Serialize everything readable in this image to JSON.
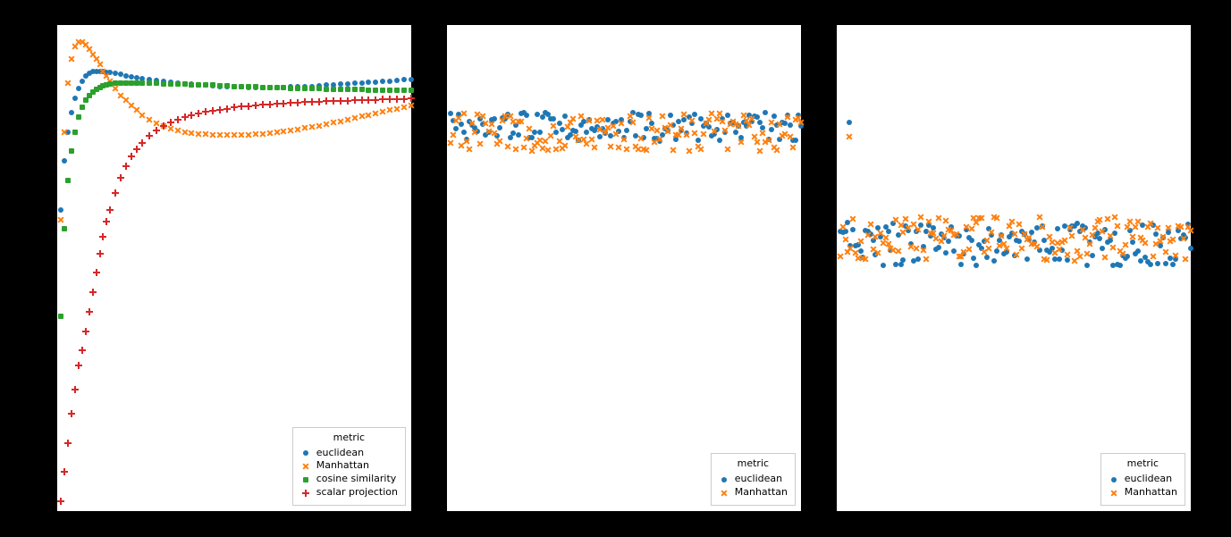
{
  "colors": {
    "euclidean": "#1f77b4",
    "manhattan": "#ff7f0e",
    "cosine": "#2ca02c",
    "scalar": "#d62728"
  },
  "legend_title": "metric",
  "legend_labels": {
    "euclidean": "euclidean",
    "manhattan": "Manhattan",
    "cosine": "cosine similarity",
    "scalar": "scalar projection"
  },
  "chart_data": [
    {
      "type": "scatter",
      "panel": "left",
      "xlim": [
        0,
        200
      ],
      "ylim": [
        0,
        1
      ],
      "legend_position": "lower right",
      "series": [
        {
          "name": "euclidean",
          "marker": "circle",
          "x": [
            2,
            4,
            6,
            8,
            10,
            12,
            14,
            16,
            18,
            20,
            22,
            24,
            26,
            28,
            30,
            33,
            36,
            39,
            42,
            45,
            48,
            52,
            56,
            60,
            64,
            68,
            72,
            76,
            80,
            84,
            88,
            92,
            96,
            100,
            104,
            108,
            112,
            116,
            120,
            124,
            128,
            132,
            136,
            140,
            144,
            148,
            152,
            156,
            160,
            164,
            168,
            172,
            176,
            180,
            184,
            188,
            192,
            196,
            200
          ],
          "y": [
            0.62,
            0.72,
            0.78,
            0.82,
            0.85,
            0.87,
            0.885,
            0.895,
            0.9,
            0.905,
            0.905,
            0.905,
            0.905,
            0.903,
            0.902,
            0.9,
            0.898,
            0.896,
            0.894,
            0.892,
            0.89,
            0.888,
            0.886,
            0.884,
            0.882,
            0.88,
            0.879,
            0.878,
            0.877,
            0.876,
            0.875,
            0.874,
            0.874,
            0.873,
            0.873,
            0.872,
            0.872,
            0.872,
            0.872,
            0.872,
            0.872,
            0.873,
            0.873,
            0.874,
            0.874,
            0.875,
            0.876,
            0.877,
            0.878,
            0.879,
            0.88,
            0.881,
            0.882,
            0.883,
            0.884,
            0.885,
            0.886,
            0.887,
            0.888
          ]
        },
        {
          "name": "Manhattan",
          "marker": "x",
          "x": [
            2,
            4,
            6,
            8,
            10,
            12,
            14,
            16,
            18,
            20,
            22,
            24,
            26,
            28,
            30,
            33,
            36,
            39,
            42,
            45,
            48,
            52,
            56,
            60,
            64,
            68,
            72,
            76,
            80,
            84,
            88,
            92,
            96,
            100,
            104,
            108,
            112,
            116,
            120,
            124,
            128,
            132,
            136,
            140,
            144,
            148,
            152,
            156,
            160,
            164,
            168,
            172,
            176,
            180,
            184,
            188,
            192,
            196,
            200
          ],
          "y": [
            0.6,
            0.78,
            0.88,
            0.93,
            0.955,
            0.965,
            0.965,
            0.96,
            0.95,
            0.94,
            0.93,
            0.92,
            0.905,
            0.895,
            0.885,
            0.87,
            0.855,
            0.845,
            0.835,
            0.825,
            0.815,
            0.805,
            0.798,
            0.792,
            0.787,
            0.783,
            0.78,
            0.778,
            0.776,
            0.775,
            0.774,
            0.773,
            0.773,
            0.773,
            0.773,
            0.774,
            0.775,
            0.776,
            0.777,
            0.779,
            0.781,
            0.783,
            0.785,
            0.788,
            0.79,
            0.793,
            0.796,
            0.799,
            0.802,
            0.805,
            0.808,
            0.812,
            0.815,
            0.818,
            0.822,
            0.825,
            0.828,
            0.831,
            0.834
          ]
        },
        {
          "name": "cosine similarity",
          "marker": "square",
          "x": [
            2,
            4,
            6,
            8,
            10,
            12,
            14,
            16,
            18,
            20,
            22,
            24,
            26,
            28,
            30,
            33,
            36,
            39,
            42,
            45,
            48,
            52,
            56,
            60,
            64,
            68,
            72,
            76,
            80,
            84,
            88,
            92,
            96,
            100,
            104,
            108,
            112,
            116,
            120,
            124,
            128,
            132,
            136,
            140,
            144,
            148,
            152,
            156,
            160,
            164,
            168,
            172,
            176,
            180,
            184,
            188,
            192,
            196,
            200
          ],
          "y": [
            0.4,
            0.58,
            0.68,
            0.74,
            0.78,
            0.81,
            0.83,
            0.845,
            0.855,
            0.862,
            0.868,
            0.872,
            0.875,
            0.877,
            0.879,
            0.88,
            0.881,
            0.881,
            0.881,
            0.881,
            0.881,
            0.88,
            0.88,
            0.879,
            0.879,
            0.878,
            0.878,
            0.877,
            0.877,
            0.876,
            0.876,
            0.875,
            0.875,
            0.874,
            0.874,
            0.873,
            0.873,
            0.872,
            0.872,
            0.871,
            0.871,
            0.87,
            0.87,
            0.869,
            0.869,
            0.869,
            0.868,
            0.868,
            0.868,
            0.867,
            0.867,
            0.867,
            0.866,
            0.866,
            0.866,
            0.865,
            0.865,
            0.865,
            0.865
          ]
        },
        {
          "name": "scalar projection",
          "marker": "plus",
          "x": [
            2,
            4,
            6,
            8,
            10,
            12,
            14,
            16,
            18,
            20,
            22,
            24,
            26,
            28,
            30,
            33,
            36,
            39,
            42,
            45,
            48,
            52,
            56,
            60,
            64,
            68,
            72,
            76,
            80,
            84,
            88,
            92,
            96,
            100,
            104,
            108,
            112,
            116,
            120,
            124,
            128,
            132,
            136,
            140,
            144,
            148,
            152,
            156,
            160,
            164,
            168,
            172,
            176,
            180,
            184,
            188,
            192,
            196,
            200
          ],
          "y": [
            0.02,
            0.08,
            0.14,
            0.2,
            0.25,
            0.3,
            0.33,
            0.37,
            0.41,
            0.45,
            0.49,
            0.53,
            0.565,
            0.595,
            0.62,
            0.655,
            0.685,
            0.71,
            0.73,
            0.745,
            0.758,
            0.772,
            0.783,
            0.792,
            0.799,
            0.805,
            0.81,
            0.814,
            0.818,
            0.821,
            0.824,
            0.826,
            0.828,
            0.83,
            0.832,
            0.833,
            0.834,
            0.836,
            0.837,
            0.838,
            0.839,
            0.84,
            0.84,
            0.841,
            0.842,
            0.842,
            0.843,
            0.843,
            0.844,
            0.844,
            0.845,
            0.845,
            0.846,
            0.846,
            0.847,
            0.847,
            0.848,
            0.848,
            0.849
          ]
        }
      ]
    },
    {
      "type": "scatter",
      "panel": "middle",
      "xlim": [
        0,
        200
      ],
      "ylim": [
        0,
        1
      ],
      "legend_position": "lower right",
      "note": "values shown as a noisy horizontal band; y-values below are approximate readings from the panel",
      "series": [
        {
          "name": "euclidean",
          "marker": "circle",
          "x_range": [
            2,
            200
          ],
          "n_points": 130,
          "y_center": 0.79,
          "y_spread": 0.03
        },
        {
          "name": "Manhattan",
          "marker": "x",
          "x_range": [
            2,
            200
          ],
          "n_points": 130,
          "y_center": 0.78,
          "y_spread": 0.04
        }
      ]
    },
    {
      "type": "scatter",
      "panel": "right",
      "xlim": [
        0,
        200
      ],
      "ylim": [
        0,
        1
      ],
      "legend_position": "lower right",
      "note": "two outlier points near x≈6–8 sit well above the main band",
      "outliers": [
        {
          "name": "euclidean",
          "x": 7,
          "y": 0.8
        },
        {
          "name": "Manhattan",
          "x": 7,
          "y": 0.77
        }
      ],
      "series": [
        {
          "name": "euclidean",
          "marker": "circle",
          "x_range": [
            2,
            200
          ],
          "n_points": 140,
          "y_center": 0.55,
          "y_spread": 0.045
        },
        {
          "name": "Manhattan",
          "marker": "x",
          "x_range": [
            2,
            200
          ],
          "n_points": 140,
          "y_center": 0.56,
          "y_spread": 0.045
        }
      ]
    }
  ]
}
